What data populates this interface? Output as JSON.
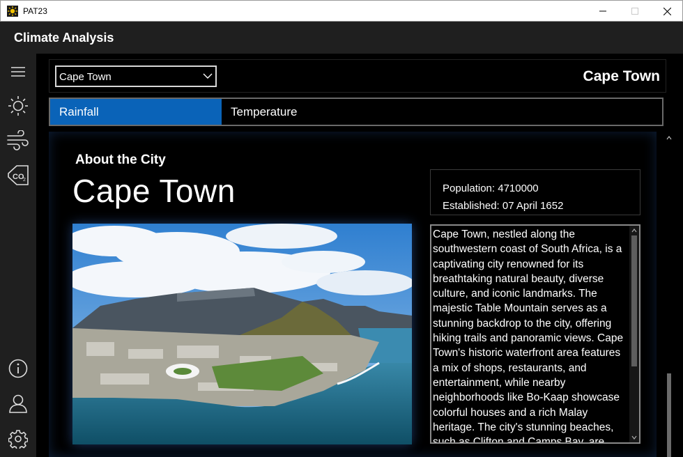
{
  "window": {
    "title": "PAT23",
    "controls": {
      "minimize": "minimize-icon",
      "maximize": "maximize-icon",
      "close": "close-icon"
    }
  },
  "app": {
    "title": "Climate Analysis"
  },
  "rail": {
    "items": [
      {
        "icon": "hamburger-menu-icon"
      },
      {
        "icon": "sun-icon"
      },
      {
        "icon": "wind-icon"
      },
      {
        "icon": "co2-icon"
      },
      {
        "icon": "info-icon"
      },
      {
        "icon": "user-icon"
      },
      {
        "icon": "gear-icon"
      }
    ]
  },
  "topbar": {
    "city_select": "Cape Town",
    "city_heading": "Cape Town"
  },
  "tabs": [
    {
      "label": "Rainfall",
      "selected": true
    },
    {
      "label": "Temperature",
      "selected": false
    }
  ],
  "about": {
    "heading": "About the City",
    "city_name": "Cape Town",
    "population_label": "Population: 4710000",
    "established_label": "Established: 07 April 1652",
    "description": "Cape Town, nestled along the southwestern coast of South Africa, is a captivating city renowned for its breathtaking natural beauty, diverse culture, and iconic landmarks. The majestic Table Mountain serves as a stunning backdrop to the city, offering hiking trails and panoramic views. Cape Town's historic waterfront area features a mix of shops, restaurants, and entertainment, while nearby neighborhoods like Bo-Kaap showcase colorful houses and a rich Malay heritage. The city's stunning beaches, such as Clifton and Camps Bay, are"
  },
  "colors": {
    "accent": "#0a63b8",
    "chrome": "#1f1f1f",
    "background": "#000000"
  }
}
